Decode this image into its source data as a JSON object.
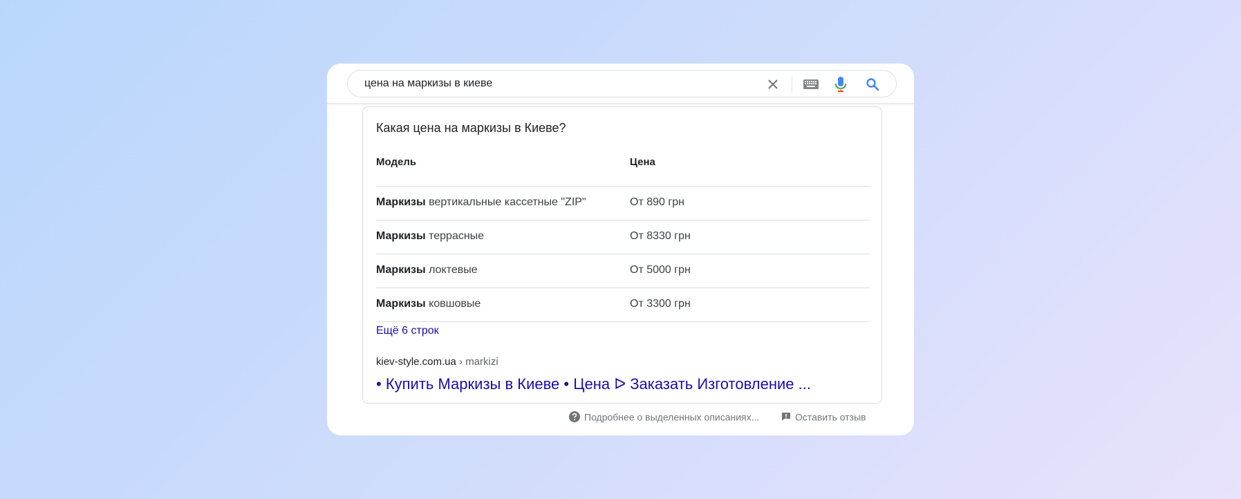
{
  "search": {
    "query": "цена на маркизы в киеве"
  },
  "snippet": {
    "question": "Какая цена на маркизы в Киеве?",
    "columns": [
      "Модель",
      "Цена"
    ],
    "rows": [
      {
        "bold": "Маркизы",
        "rest": " вертикальные кассетные \"ZIP\"",
        "price": "От 890 грн"
      },
      {
        "bold": "Маркизы",
        "rest": " террасные",
        "price": "От 8330 грн"
      },
      {
        "bold": "Маркизы",
        "rest": " локтевые",
        "price": "От 5000 грн"
      },
      {
        "bold": "Маркизы",
        "rest": " ковшовые",
        "price": "От 3300 грн"
      }
    ],
    "more_rows": "Ещё 6 строк",
    "cite_domain": "kiev-style.com.ua",
    "cite_path": " › markizi",
    "result_title": "• Купить Маркизы в Киеве • Цена ᐅ Заказать Изготовление ..."
  },
  "footer": {
    "about": "Подробнее о выделенных описаниях...",
    "feedback": "Оставить отзыв"
  },
  "colors": {
    "link": "#1a0dab",
    "mic_blue": "#4285f4",
    "mic_red": "#ea4335"
  }
}
